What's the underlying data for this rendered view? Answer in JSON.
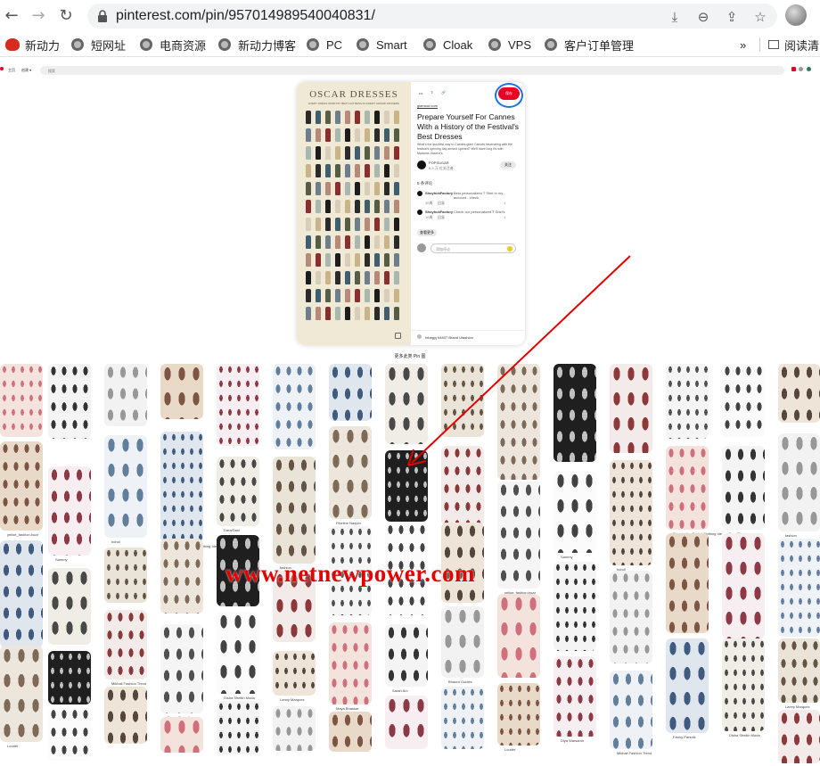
{
  "browser": {
    "url_text": "pinterest.com/pin/957014989540040831/",
    "nav": {
      "back_icon": "arrow-left-icon",
      "forward_icon": "arrow-right-icon",
      "reload_icon": "reload-icon"
    },
    "url_actions": [
      "download-icon",
      "zoom-icon",
      "share-icon",
      "star-icon"
    ]
  },
  "bookmarks": {
    "items": [
      {
        "label": "新动力",
        "icon": "red-logo-icon"
      },
      {
        "label": "短网址",
        "icon": "globe-icon"
      },
      {
        "label": "电商资源",
        "icon": "globe-icon"
      },
      {
        "label": "新动力博客",
        "icon": "globe-icon"
      },
      {
        "label": "PC",
        "icon": "globe-icon"
      },
      {
        "label": "Smart",
        "icon": "globe-icon"
      },
      {
        "label": "Cloak",
        "icon": "globe-icon"
      },
      {
        "label": "VPS",
        "icon": "globe-icon"
      },
      {
        "label": "客户订单管理",
        "icon": "globe-icon"
      }
    ],
    "more_label": "»",
    "reading_list_label": "阅读清"
  },
  "pinterest": {
    "header": {
      "home_label": "主页",
      "explore_label": "创建 ▾",
      "search_label": "搜索"
    },
    "pin": {
      "image_title": "OSCAR DRESSES",
      "image_subtitle": "EVERY DRESS WORN BY BEST ACTRESS ACADEMY AWARD WINNERS",
      "save_label": "保存",
      "source": "glamour.com",
      "title": "Prepare Yourself For Cannes With a History of the Festival's Best Dresses",
      "description": "What's the quickest way to Cannes-glam Cannes fascinating with the festival's opening day arrived opened? We'll have long it's with Madame-Glamor's",
      "author_name": "POPSUGAR",
      "author_followers": "6.9 万 位关注者",
      "follow_label": "关注",
      "comments_header": "5 条评论",
      "comments": [
        {
          "user": "ShoyhckFactory",
          "text": "Best personalized T Shirt in my account - check",
          "time": "10周",
          "reply": "回复",
          "likes": "1"
        },
        {
          "user": "ShoyhckFactory",
          "text": "Check our personalized T Shirt's",
          "time": "10周",
          "reply": "回复",
          "likes": "1"
        }
      ],
      "see_more": "查看更多",
      "comment_placeholder": "添加评论",
      "board_caption": "Inbagyj 9483T Brand Ufashion"
    },
    "more_title": "更多此类 Pin 图",
    "grid_captions": [
      "yelloe_fashion.buzz",
      "Louder",
      "Sammy",
      "Diya Warsamir",
      "hdroll",
      "Mikhail Fashion Trend",
      "Pinspiration Dark | Clothing Ide",
      "Fanny Parsnik",
      "Dara/Dani",
      "Disha Sheikh Moda",
      "fashion",
      "Lanny Marquez",
      "Fibeline Naquin",
      "Maya Bhaskar",
      "Myra-Ai",
      "Sarah Arc",
      "Studio",
      "Bhaura Guides"
    ],
    "watermark": "www.netnewpower.com"
  },
  "colors": {
    "pinterest_red": "#e60023",
    "annotation_blue": "#1a73e8",
    "annotation_red": "#e30000"
  }
}
